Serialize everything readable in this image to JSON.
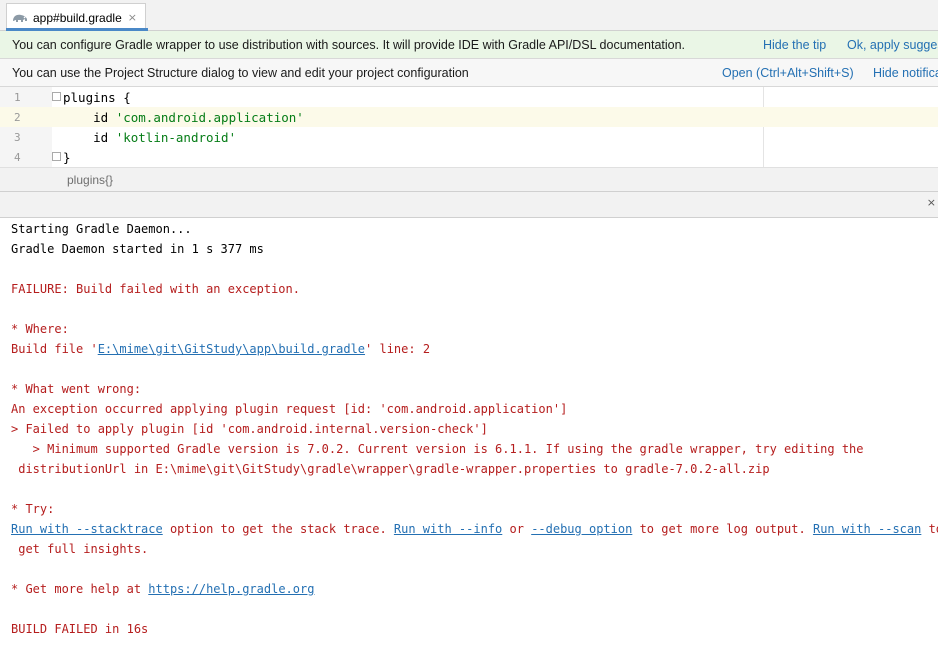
{
  "tab": {
    "title": "app#build.gradle",
    "close_glyph": "×",
    "icon": "gradle-elephant-icon"
  },
  "banner_gradle": {
    "message": "You can configure Gradle wrapper to use distribution with sources. It will provide IDE with Gradle API/DSL documentation.",
    "hide_tip": "Hide the tip",
    "apply": "Ok, apply sugges"
  },
  "banner_structure": {
    "message": "You can use the Project Structure dialog to view and edit your project configuration",
    "open": "Open (Ctrl+Alt+Shift+S)",
    "hide": "Hide notifica"
  },
  "editor": {
    "lines": [
      {
        "num": "1",
        "pre": "plugins {",
        "str": "",
        "post": ""
      },
      {
        "num": "2",
        "pre": "    id ",
        "str": "'com.android.application'",
        "post": ""
      },
      {
        "num": "3",
        "pre": "    id ",
        "str": "'kotlin-android'",
        "post": ""
      },
      {
        "num": "4",
        "pre": "}",
        "str": "",
        "post": ""
      }
    ]
  },
  "breadcrumb": "plugins{}",
  "toolwindow": {
    "close_glyph": "×"
  },
  "console": {
    "l1": "Starting Gradle Daemon...",
    "l2": "Gradle Daemon started in 1 s 377 ms",
    "failure": "FAILURE: Build failed with an exception.",
    "where": "* Where:",
    "build_file_pre": "Build file '",
    "build_file_link": "E:\\mime\\git\\GitStudy\\app\\build.gradle",
    "build_file_post": "' line: 2",
    "what_wrong": "* What went wrong:",
    "exc": "An exception occurred applying plugin request [id: 'com.android.application']",
    "failed_apply": "> Failed to apply plugin [id 'com.android.internal.version-check']",
    "min_ver": "   > Minimum supported Gradle version is 7.0.2. Current version is 6.1.1. If using the gradle wrapper, try editing the",
    "dist_url": " distributionUrl in E:\\mime\\git\\GitStudy\\gradle\\wrapper\\gradle-wrapper.properties to gradle-7.0.2-all.zip",
    "try": "* Try:",
    "run_stacktrace": "Run with --stacktrace",
    "t1": " option to get the stack trace. ",
    "run_info": "Run with --info",
    "t2": " or ",
    "debug_option": "--debug option",
    "t3": " to get more log output. ",
    "run_scan": "Run with --scan",
    "t4": " to",
    "full_insights": " get full insights.",
    "help_pre": "* Get more help at ",
    "help_link": "https://help.gradle.org",
    "build_failed": "BUILD FAILED in 16s"
  }
}
